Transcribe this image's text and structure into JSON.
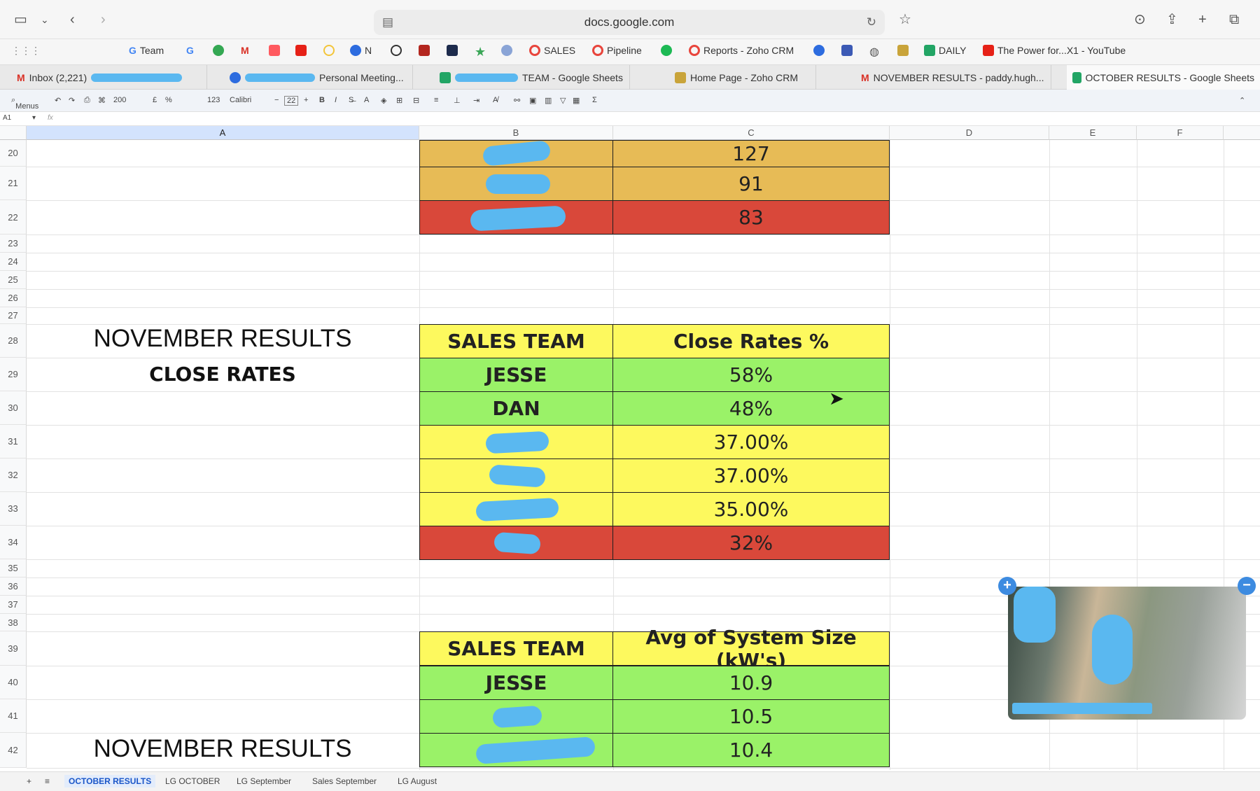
{
  "browser": {
    "url": "docs.google.com"
  },
  "bookmarks": [
    {
      "label": "Team"
    },
    {
      "label": "N"
    },
    {
      "label": "SALES"
    },
    {
      "label": "Pipeline"
    },
    {
      "label": "Reports - Zoho CRM"
    },
    {
      "label": "DAILY"
    },
    {
      "label": "The Power for...X1 - YouTube"
    }
  ],
  "tabs": [
    {
      "label": "Inbox (2,221)"
    },
    {
      "label": "Personal Meeting..."
    },
    {
      "label": "TEAM - Google Sheets"
    },
    {
      "label": "Home Page - Zoho CRM"
    },
    {
      "label": "NOVEMBER RESULTS - paddy.hugh..."
    },
    {
      "label": "OCTOBER RESULTS - Google Sheets"
    }
  ],
  "toolbar": {
    "menus": "Menus",
    "zoom": "200",
    "currency": "£",
    "percent": "%",
    "number_format": "123",
    "font": "Calibri",
    "font_size": "22",
    "bold": "B",
    "italic": "I",
    "sum": "Σ"
  },
  "formula_bar": {
    "cell_ref": "A1",
    "fx": "fx"
  },
  "columns": [
    "A",
    "B",
    "C",
    "D",
    "E",
    "F"
  ],
  "rows": [
    "20",
    "21",
    "22",
    "23",
    "24",
    "25",
    "26",
    "27",
    "28",
    "29",
    "30",
    "31",
    "32",
    "33",
    "34",
    "35",
    "36",
    "37",
    "38",
    "39",
    "40",
    "41",
    "42"
  ],
  "table_top": {
    "values": [
      "127",
      "91",
      "83"
    ]
  },
  "labels": {
    "nov_results_1": "NOVEMBER RESULTS",
    "close_rates": "CLOSE RATES",
    "nov_results_2": "NOVEMBER RESULTS"
  },
  "table_close": {
    "header_team": "SALES TEAM",
    "header_value": "Close Rates %",
    "rows": [
      {
        "name": "JESSE",
        "value": "58%"
      },
      {
        "name": "DAN",
        "value": "48%"
      },
      {
        "name": "",
        "value": "37.00%"
      },
      {
        "name": "",
        "value": "37.00%"
      },
      {
        "name": "",
        "value": "35.00%"
      },
      {
        "name": "",
        "value": "32%"
      }
    ]
  },
  "table_size": {
    "header_team": "SALES TEAM",
    "header_value": "Avg of System Size (kW's)",
    "rows": [
      {
        "name": "JESSE",
        "value": "10.9"
      },
      {
        "name": "",
        "value": "10.5"
      },
      {
        "name": "",
        "value": "10.4"
      }
    ]
  },
  "sheet_tabs": [
    {
      "label": "OCTOBER RESULTS"
    },
    {
      "label": "LG OCTOBER"
    },
    {
      "label": "LG September"
    },
    {
      "label": "Sales September"
    },
    {
      "label": "LG August"
    }
  ],
  "colors": {
    "orange": "#e7bb56",
    "red": "#d9483a",
    "yellow": "#fdf95e",
    "green": "#9af268",
    "redaction": "#5ab8f0"
  }
}
